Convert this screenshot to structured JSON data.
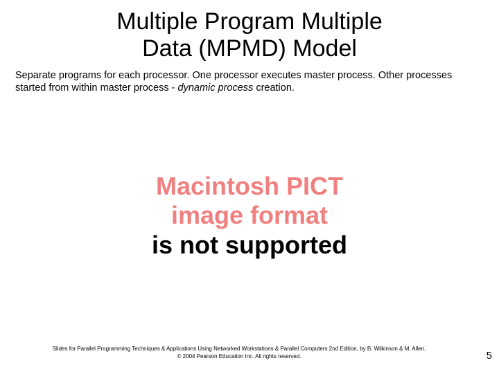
{
  "title": {
    "line1": "Multiple Program Multiple",
    "line2": "Data (MPMD) Model"
  },
  "body": {
    "part1": "Separate programs for each processor. One processor executes master process. Other processes started from within master process - ",
    "italic": "dynamic process",
    "part2": " creation."
  },
  "placeholder": {
    "line1a": "Macintosh PICT",
    "line2a": "image format",
    "line3": "is not supported"
  },
  "footer": {
    "line1": "Slides for Parallel Programming Techniques & Applications Using Networked Workstations & Parallel Computers 2nd Edition, by B. Wilkinson & M. Allen,",
    "line2": "© 2004 Pearson Education Inc. All rights reserved."
  },
  "page_number": "5"
}
